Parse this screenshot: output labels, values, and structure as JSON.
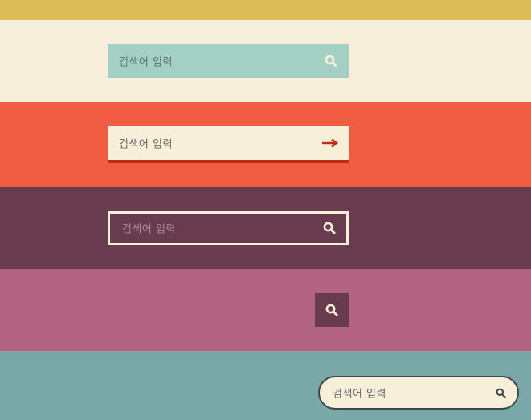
{
  "colors": {
    "gold": "#dbbc56",
    "cream": "#f8efda",
    "coral": "#f15d43",
    "plum": "#683c4e",
    "rose": "#b26380",
    "teal": "#7aa8a8",
    "mint": "#a3d0c3",
    "dark_red": "#c12a14"
  },
  "searches": [
    {
      "placeholder": "검색어 입력",
      "button_icon": "search-icon"
    },
    {
      "placeholder": "검색어 입력",
      "button_icon": "arrow-right-icon"
    },
    {
      "placeholder": "검색어 입력",
      "button_icon": "search-icon"
    },
    {
      "placeholder": "",
      "button_icon": "search-icon"
    },
    {
      "placeholder": "검색어 입력",
      "button_icon": "search-icon"
    }
  ]
}
